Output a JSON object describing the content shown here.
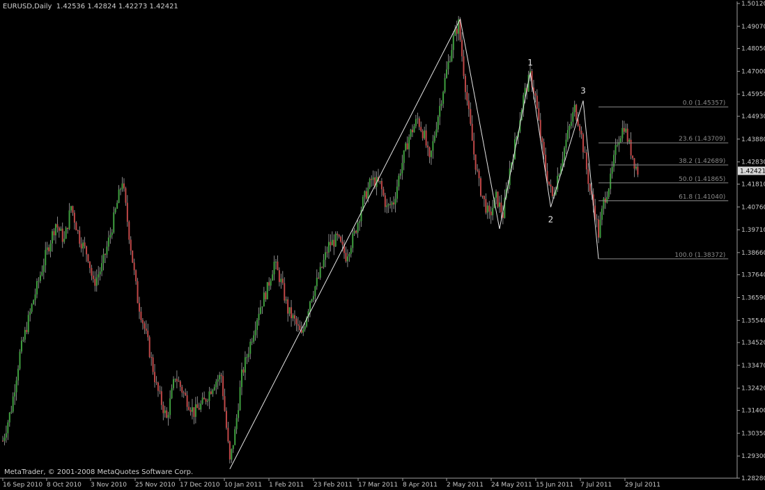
{
  "header": {
    "symbol": "EURUSD,Daily",
    "open": "1.42536",
    "high": "1.42824",
    "low": "1.42273",
    "close": "1.42421"
  },
  "copyright": "MetaTrader, © 2001-2008 MetaQuotes Software Corp.",
  "colors": {
    "background": "#000000",
    "bull": "#3f9f3f",
    "bear": "#c04848",
    "wick": "#aaaaaa",
    "lines": "#e6e6e6",
    "fibo": "#8a8a8a",
    "axis": "#a0a0a0"
  },
  "chart_data": {
    "type": "candlestick",
    "ylim": [
      1.2828,
      1.5012
    ],
    "y_ticks": [
      "1.50120",
      "1.49070",
      "1.48050",
      "1.47000",
      "1.45950",
      "1.44930",
      "1.43880",
      "1.42830",
      "1.41810",
      "1.40760",
      "1.39710",
      "1.38660",
      "1.37640",
      "1.36590",
      "1.35540",
      "1.34520",
      "1.33470",
      "1.32420",
      "1.31400",
      "1.30350",
      "1.29300",
      "1.28280"
    ],
    "x_ticks": [
      "16 Sep 2010",
      "8 Oct 2010",
      "3 Nov 2010",
      "25 Nov 2010",
      "17 Dec 2010",
      "10 Jan 2011",
      "1 Feb 2011",
      "23 Feb 2011",
      "17 Mar 2011",
      "8 Apr 2011",
      "2 May 2011",
      "24 May 2011",
      "15 Jun 2011",
      "7 Jul 2011",
      "29 Jul 2011"
    ],
    "current_price": "1.42421",
    "price_path": [
      [
        0,
        1.3
      ],
      [
        5,
        1.315
      ],
      [
        10,
        1.34
      ],
      [
        18,
        1.365
      ],
      [
        25,
        1.385
      ],
      [
        31,
        1.4
      ],
      [
        36,
        1.392
      ],
      [
        40,
        1.408
      ],
      [
        45,
        1.393
      ],
      [
        50,
        1.385
      ],
      [
        53,
        1.372
      ],
      [
        58,
        1.38
      ],
      [
        63,
        1.395
      ],
      [
        70,
        1.42
      ],
      [
        74,
        1.395
      ],
      [
        79,
        1.365
      ],
      [
        85,
        1.345
      ],
      [
        90,
        1.325
      ],
      [
        96,
        1.31
      ],
      [
        101,
        1.33
      ],
      [
        107,
        1.32
      ],
      [
        112,
        1.313
      ],
      [
        118,
        1.318
      ],
      [
        124,
        1.327
      ],
      [
        128,
        1.33
      ],
      [
        133,
        1.29
      ],
      [
        136,
        1.304
      ],
      [
        140,
        1.33
      ],
      [
        145,
        1.345
      ],
      [
        150,
        1.36
      ],
      [
        155,
        1.37
      ],
      [
        159,
        1.382
      ],
      [
        163,
        1.373
      ],
      [
        167,
        1.36
      ],
      [
        171,
        1.355
      ],
      [
        175,
        1.348
      ],
      [
        180,
        1.365
      ],
      [
        185,
        1.375
      ],
      [
        191,
        1.39
      ],
      [
        196,
        1.393
      ],
      [
        201,
        1.385
      ],
      [
        206,
        1.395
      ],
      [
        211,
        1.41
      ],
      [
        216,
        1.42
      ],
      [
        221,
        1.418
      ],
      [
        225,
        1.407
      ],
      [
        229,
        1.41
      ],
      [
        233,
        1.425
      ],
      [
        238,
        1.44
      ],
      [
        243,
        1.448
      ],
      [
        247,
        1.44
      ],
      [
        250,
        1.428
      ],
      [
        255,
        1.45
      ],
      [
        260,
        1.47
      ],
      [
        264,
        1.485
      ],
      [
        267,
        1.492
      ],
      [
        270,
        1.47
      ],
      [
        273,
        1.45
      ],
      [
        276,
        1.432
      ],
      [
        279,
        1.418
      ],
      [
        282,
        1.41
      ],
      [
        285,
        1.403
      ],
      [
        289,
        1.412
      ],
      [
        293,
        1.404
      ],
      [
        297,
        1.425
      ],
      [
        301,
        1.44
      ],
      [
        305,
        1.458
      ],
      [
        309,
        1.468
      ],
      [
        312,
        1.458
      ],
      [
        315,
        1.44
      ],
      [
        318,
        1.425
      ],
      [
        320,
        1.418
      ],
      [
        322,
        1.412
      ],
      [
        326,
        1.425
      ],
      [
        330,
        1.438
      ],
      [
        335,
        1.453
      ],
      [
        338,
        1.445
      ],
      [
        341,
        1.43
      ],
      [
        344,
        1.415
      ],
      [
        347,
        1.405
      ],
      [
        349,
        1.395
      ],
      [
        352,
        1.41
      ],
      [
        356,
        1.42
      ],
      [
        360,
        1.438
      ],
      [
        364,
        1.445
      ],
      [
        367,
        1.436
      ],
      [
        370,
        1.428
      ],
      [
        372,
        1.424
      ]
    ],
    "zigzag": [
      {
        "index": 133,
        "price": 1.287
      },
      {
        "index": 268,
        "price": 1.494
      },
      {
        "index": 291,
        "price": 1.3975
      },
      {
        "index": 309,
        "price": 1.4695
      },
      {
        "index": 321,
        "price": 1.4075
      },
      {
        "index": 340,
        "price": 1.4565
      },
      {
        "index": 349,
        "price": 1.3837
      }
    ],
    "wave_labels": [
      {
        "text": "1",
        "index": 309,
        "price": 1.4695,
        "pos": "above"
      },
      {
        "text": "2",
        "index": 321,
        "price": 1.4075,
        "pos": "below"
      },
      {
        "text": "3",
        "index": 340,
        "price": 1.4565,
        "pos": "above"
      }
    ],
    "fibonacci": {
      "from_index": 349,
      "to_index": 425,
      "levels": [
        {
          "label": "0.0 (1.45357)",
          "price": 1.45357
        },
        {
          "label": "23.6 (1.43709)",
          "price": 1.43709
        },
        {
          "label": "38.2 (1.42689)",
          "price": 1.42689
        },
        {
          "label": "50.0 (1.41865)",
          "price": 1.41865
        },
        {
          "label": "61.8 (1.41040)",
          "price": 1.4104
        },
        {
          "label": "100.0 (1.38372)",
          "price": 1.38372
        }
      ]
    }
  }
}
